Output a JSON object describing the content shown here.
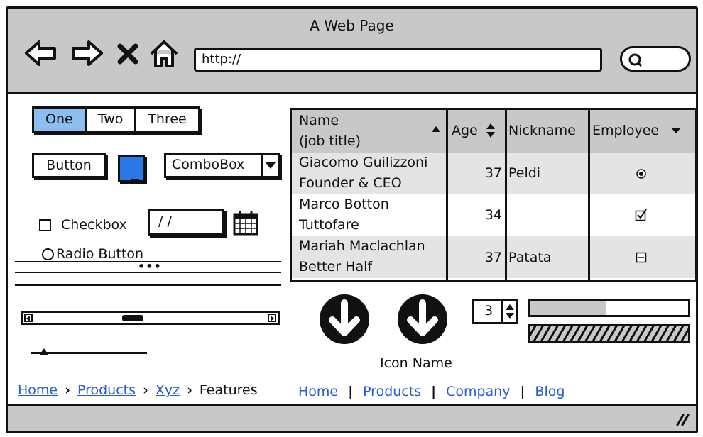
{
  "window": {
    "title": "A Web Page",
    "url": "http://"
  },
  "tabs": [
    {
      "label": "One",
      "active": true
    },
    {
      "label": "Two",
      "active": false
    },
    {
      "label": "Three",
      "active": false
    }
  ],
  "controls": {
    "button_label": "Button",
    "combobox_label": "ComboBox",
    "checkbox_label": "Checkbox",
    "date_value": "/ /",
    "radio_label": "Radio Button",
    "color_picker_color": "#2a77e8"
  },
  "table": {
    "columns": [
      "Name\n(job title)",
      "Age",
      "Nickname",
      "Employee"
    ],
    "column_name_line1": "Name",
    "column_name_line2": "(job title)",
    "rows": [
      {
        "name": "Giacomo Guilizzoni",
        "title": "Founder & CEO",
        "age": "37",
        "nickname": "Peldi",
        "employee": "radio-selected"
      },
      {
        "name": "Marco Botton",
        "title": "Tuttofare",
        "age": "34",
        "nickname": "",
        "employee": "checkbox-checked"
      },
      {
        "name": "Mariah Maclachlan",
        "title": "Better Half",
        "age": "37",
        "nickname": "Patata",
        "employee": "collapse-box"
      }
    ]
  },
  "widgets": {
    "icon_name": "Icon Name",
    "stepper_value": "3",
    "progress_fraction": 0.48
  },
  "breadcrumb": [
    {
      "label": "Home",
      "link": true
    },
    {
      "label": "Products",
      "link": true
    },
    {
      "label": "Xyz",
      "link": true
    },
    {
      "label": "Features",
      "link": false
    }
  ],
  "links": [
    "Home",
    "Products",
    "Company",
    "Blog"
  ],
  "colors": {
    "chrome_gray": "#c8c8c8",
    "active_tab": "#8ebdf2",
    "link": "#2a5bd7",
    "alt_row": "#e4e4e4"
  }
}
